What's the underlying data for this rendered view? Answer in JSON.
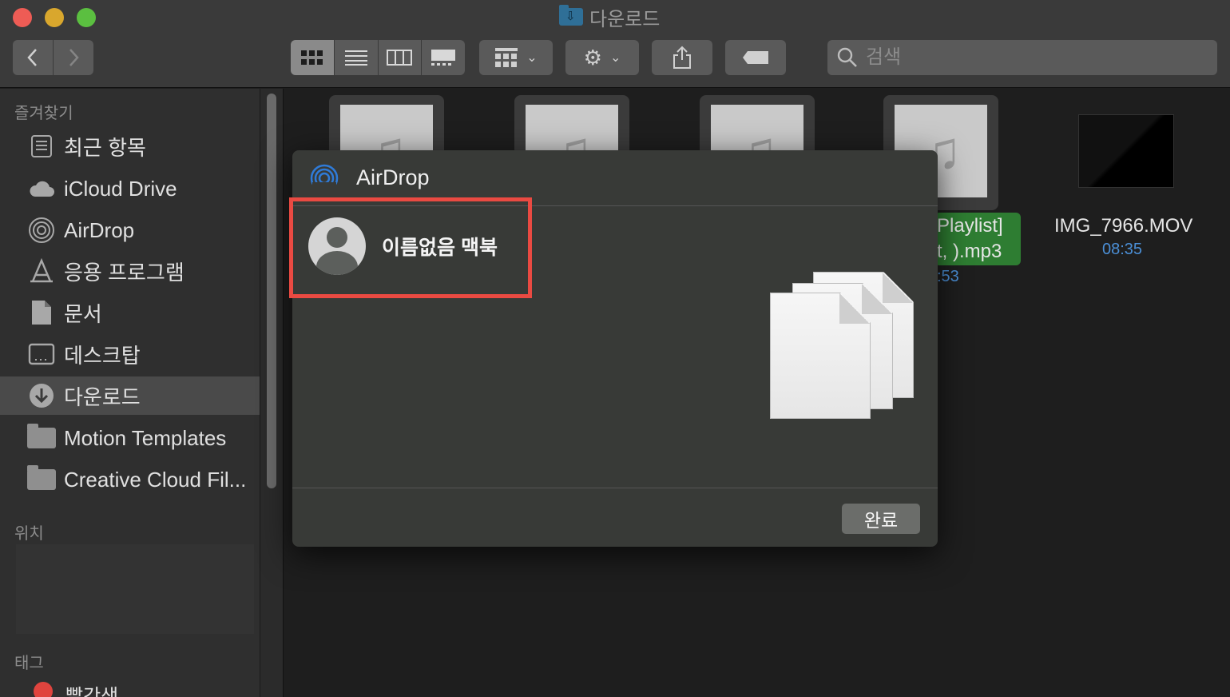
{
  "window": {
    "title": "다운로드",
    "traffic_lights": [
      "close",
      "minimize",
      "zoom"
    ]
  },
  "toolbar": {
    "back_icon": "chevron-left-icon",
    "forward_icon": "chevron-right-icon",
    "view_modes": [
      "icon-view",
      "list-view",
      "column-view",
      "gallery-view"
    ],
    "active_view": "icon-view",
    "search_placeholder": "검색"
  },
  "sidebar": {
    "favorites_header": "즐겨찾기",
    "items": [
      {
        "label": "최근 항목",
        "icon": "recents-icon"
      },
      {
        "label": "iCloud Drive",
        "icon": "cloud-icon"
      },
      {
        "label": "AirDrop",
        "icon": "airdrop-icon"
      },
      {
        "label": "응용 프로그램",
        "icon": "applications-icon"
      },
      {
        "label": "문서",
        "icon": "document-icon"
      },
      {
        "label": "데스크탑",
        "icon": "desktop-icon"
      },
      {
        "label": "다운로드",
        "icon": "download-icon",
        "selected": true
      },
      {
        "label": "Motion Templates",
        "icon": "folder-icon"
      },
      {
        "label": "Creative Cloud Fil...",
        "icon": "folder-icon"
      }
    ],
    "locations_header": "위치",
    "tags_header": "태그",
    "tags": [
      {
        "label": "빨간색",
        "color": "#e0443e"
      }
    ]
  },
  "files": {
    "partial_label_1": "Playlist]",
    "partial_label_2": "t,  ).mp3",
    "partial_time": ":53",
    "video_name": "IMG_7966.MOV",
    "video_duration": "08:35"
  },
  "airdrop_sheet": {
    "title": "AirDrop",
    "device_name": "이름없음 맥북",
    "done_button": "완료"
  },
  "colors": {
    "highlight": "#ea4a42",
    "airdrop_blue": "#2f7bd8",
    "selected_file_green": "#2e7d32",
    "duration_blue": "#4b8fd6"
  }
}
